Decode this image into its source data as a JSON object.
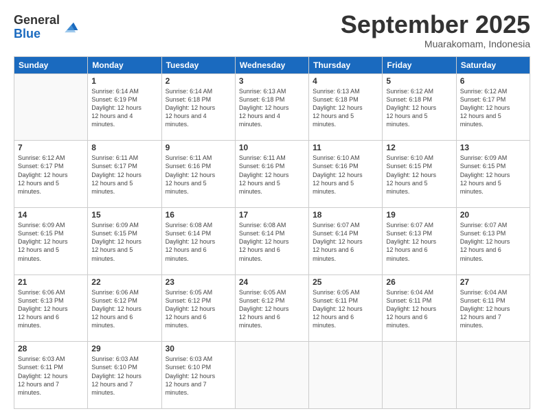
{
  "logo": {
    "general": "General",
    "blue": "Blue"
  },
  "header": {
    "title": "September 2025",
    "subtitle": "Muarakomam, Indonesia"
  },
  "weekdays": [
    "Sunday",
    "Monday",
    "Tuesday",
    "Wednesday",
    "Thursday",
    "Friday",
    "Saturday"
  ],
  "weeks": [
    [
      {
        "day": null
      },
      {
        "day": 1,
        "sunrise": "6:14 AM",
        "sunset": "6:19 PM",
        "daylight": "12 hours and 4 minutes."
      },
      {
        "day": 2,
        "sunrise": "6:14 AM",
        "sunset": "6:18 PM",
        "daylight": "12 hours and 4 minutes."
      },
      {
        "day": 3,
        "sunrise": "6:13 AM",
        "sunset": "6:18 PM",
        "daylight": "12 hours and 4 minutes."
      },
      {
        "day": 4,
        "sunrise": "6:13 AM",
        "sunset": "6:18 PM",
        "daylight": "12 hours and 5 minutes."
      },
      {
        "day": 5,
        "sunrise": "6:12 AM",
        "sunset": "6:18 PM",
        "daylight": "12 hours and 5 minutes."
      },
      {
        "day": 6,
        "sunrise": "6:12 AM",
        "sunset": "6:17 PM",
        "daylight": "12 hours and 5 minutes."
      }
    ],
    [
      {
        "day": 7,
        "sunrise": "6:12 AM",
        "sunset": "6:17 PM",
        "daylight": "12 hours and 5 minutes."
      },
      {
        "day": 8,
        "sunrise": "6:11 AM",
        "sunset": "6:17 PM",
        "daylight": "12 hours and 5 minutes."
      },
      {
        "day": 9,
        "sunrise": "6:11 AM",
        "sunset": "6:16 PM",
        "daylight": "12 hours and 5 minutes."
      },
      {
        "day": 10,
        "sunrise": "6:11 AM",
        "sunset": "6:16 PM",
        "daylight": "12 hours and 5 minutes."
      },
      {
        "day": 11,
        "sunrise": "6:10 AM",
        "sunset": "6:16 PM",
        "daylight": "12 hours and 5 minutes."
      },
      {
        "day": 12,
        "sunrise": "6:10 AM",
        "sunset": "6:15 PM",
        "daylight": "12 hours and 5 minutes."
      },
      {
        "day": 13,
        "sunrise": "6:09 AM",
        "sunset": "6:15 PM",
        "daylight": "12 hours and 5 minutes."
      }
    ],
    [
      {
        "day": 14,
        "sunrise": "6:09 AM",
        "sunset": "6:15 PM",
        "daylight": "12 hours and 5 minutes."
      },
      {
        "day": 15,
        "sunrise": "6:09 AM",
        "sunset": "6:15 PM",
        "daylight": "12 hours and 5 minutes."
      },
      {
        "day": 16,
        "sunrise": "6:08 AM",
        "sunset": "6:14 PM",
        "daylight": "12 hours and 6 minutes."
      },
      {
        "day": 17,
        "sunrise": "6:08 AM",
        "sunset": "6:14 PM",
        "daylight": "12 hours and 6 minutes."
      },
      {
        "day": 18,
        "sunrise": "6:07 AM",
        "sunset": "6:14 PM",
        "daylight": "12 hours and 6 minutes."
      },
      {
        "day": 19,
        "sunrise": "6:07 AM",
        "sunset": "6:13 PM",
        "daylight": "12 hours and 6 minutes."
      },
      {
        "day": 20,
        "sunrise": "6:07 AM",
        "sunset": "6:13 PM",
        "daylight": "12 hours and 6 minutes."
      }
    ],
    [
      {
        "day": 21,
        "sunrise": "6:06 AM",
        "sunset": "6:13 PM",
        "daylight": "12 hours and 6 minutes."
      },
      {
        "day": 22,
        "sunrise": "6:06 AM",
        "sunset": "6:12 PM",
        "daylight": "12 hours and 6 minutes."
      },
      {
        "day": 23,
        "sunrise": "6:05 AM",
        "sunset": "6:12 PM",
        "daylight": "12 hours and 6 minutes."
      },
      {
        "day": 24,
        "sunrise": "6:05 AM",
        "sunset": "6:12 PM",
        "daylight": "12 hours and 6 minutes."
      },
      {
        "day": 25,
        "sunrise": "6:05 AM",
        "sunset": "6:11 PM",
        "daylight": "12 hours and 6 minutes."
      },
      {
        "day": 26,
        "sunrise": "6:04 AM",
        "sunset": "6:11 PM",
        "daylight": "12 hours and 6 minutes."
      },
      {
        "day": 27,
        "sunrise": "6:04 AM",
        "sunset": "6:11 PM",
        "daylight": "12 hours and 7 minutes."
      }
    ],
    [
      {
        "day": 28,
        "sunrise": "6:03 AM",
        "sunset": "6:11 PM",
        "daylight": "12 hours and 7 minutes."
      },
      {
        "day": 29,
        "sunrise": "6:03 AM",
        "sunset": "6:10 PM",
        "daylight": "12 hours and 7 minutes."
      },
      {
        "day": 30,
        "sunrise": "6:03 AM",
        "sunset": "6:10 PM",
        "daylight": "12 hours and 7 minutes."
      },
      {
        "day": null
      },
      {
        "day": null
      },
      {
        "day": null
      },
      {
        "day": null
      }
    ]
  ]
}
